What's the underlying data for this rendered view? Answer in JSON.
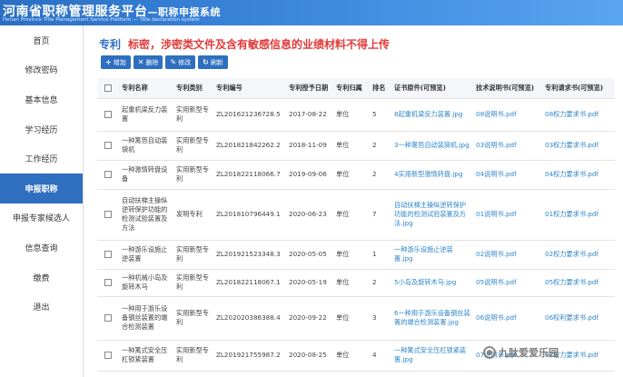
{
  "header": {
    "title": "河南省职称管理服务平台",
    "subtitle": "—职称申报系统",
    "english": "Henan Province Title Management Service Platform — Title declaration system"
  },
  "sidebar": {
    "items": [
      {
        "label": "首页",
        "active": false
      },
      {
        "label": "修改密码",
        "active": false
      },
      {
        "label": "基本信息",
        "active": false
      },
      {
        "label": "学习经历",
        "active": false
      },
      {
        "label": "工作经历",
        "active": false
      },
      {
        "label": "申报职称",
        "active": true
      },
      {
        "label": "申报专家候选人",
        "active": false
      },
      {
        "label": "信息查询",
        "active": false
      },
      {
        "label": "缴费",
        "active": false
      },
      {
        "label": "退出",
        "active": false
      }
    ]
  },
  "main": {
    "tab": "专利",
    "warning": "标密，涉密类文件及含有敏感信息的业绩材料不得上传",
    "toolbar": {
      "add": "增加",
      "delete": "删除",
      "edit": "修改",
      "refresh": "刷新"
    },
    "columns": [
      "专利名称",
      "专利类别",
      "专利编号",
      "专利授予日期",
      "专利归属",
      "排名",
      "证书原件(可预览)",
      "技术说明书(可预览)",
      "专利请求书(可预览)"
    ],
    "rows": [
      {
        "name": "起重机梁反力装置",
        "type": "实用新型专利",
        "number": "ZL201621236728.5",
        "date": "2017-08-22",
        "owner": "单位",
        "rank": "5",
        "cert": "8起重机梁反力装置.jpg",
        "spec": "08说明书.pdf",
        "req": "08权力要求书.pdf"
      },
      {
        "name": "一种篱笆自动装袋机",
        "type": "实用新型专利",
        "number": "ZL201821842262.2",
        "date": "2018-11-09",
        "owner": "单位",
        "rank": "2",
        "cert": "3一种篱笆自动装袋机.jpg",
        "spec": "03说明书.pdf",
        "req": "03权力要求书.pdf"
      },
      {
        "name": "一种激情转盘设备",
        "type": "实用新型专利",
        "number": "ZL201822118066.7",
        "date": "2019-09-06",
        "owner": "单位",
        "rank": "2",
        "cert": "4实用新型激情转盘.jpg",
        "spec": "04说明书.pdf",
        "req": "04权力要求书.pdf"
      },
      {
        "name": "自动扶梯主操纵逆转保护功能的检测试验装置及方法",
        "type": "发明专利",
        "number": "ZL201810796449.1",
        "date": "2020-06-23",
        "owner": "单位",
        "rank": "7",
        "cert": "自动扶梯主操纵逆转保护功能的检测试验装置及方法.jpg",
        "spec": "01说明书.pdf",
        "req": "01权力要求书.pdf"
      },
      {
        "name": "一种游乐设施止逆装置",
        "type": "实用新型专利",
        "number": "ZL201921523348.3",
        "date": "2020-05-05",
        "owner": "单位",
        "rank": "1",
        "cert": "一种游乐设施止逆装置.jpg",
        "spec": "02说明书.pdf",
        "req": "02权力要求书.pdf"
      },
      {
        "name": "一种机械小岛及旋转木马",
        "type": "实用新型专利",
        "number": "ZL201822118067.1",
        "date": "2020-05-19",
        "owner": "单位",
        "rank": "2",
        "cert": "5小岛及旋转木马.jpg",
        "spec": "05说明书.pdf",
        "req": "05权力要求书.pdf"
      },
      {
        "name": "一种用于游乐设备钢丝装置的端合检测装置",
        "type": "实用新型专利",
        "number": "ZL202020386388.4",
        "date": "2020-09-22",
        "owner": "单位",
        "rank": "3",
        "cert": "6一种用于游乐设备钢丝装置的端合检测装置.jpg",
        "spec": "06说明书.pdf",
        "req": "06权利要求书.pdf"
      },
      {
        "name": "一种篱式安全压杠锁紧装置",
        "type": "实用新型专利",
        "number": "ZL201921755987.2",
        "date": "2020-08-25",
        "owner": "单位",
        "rank": "4",
        "cert": "一种篱式安全压杠锁紧装置.jpg",
        "spec": "07说明书.pdf",
        "req": "07权力要求书.pdf"
      }
    ]
  },
  "watermark": "九肽爱爱乐园",
  "colors": {
    "brand": "#2f6fc0",
    "warning": "#e23a3a",
    "link": "#2f86c9"
  }
}
